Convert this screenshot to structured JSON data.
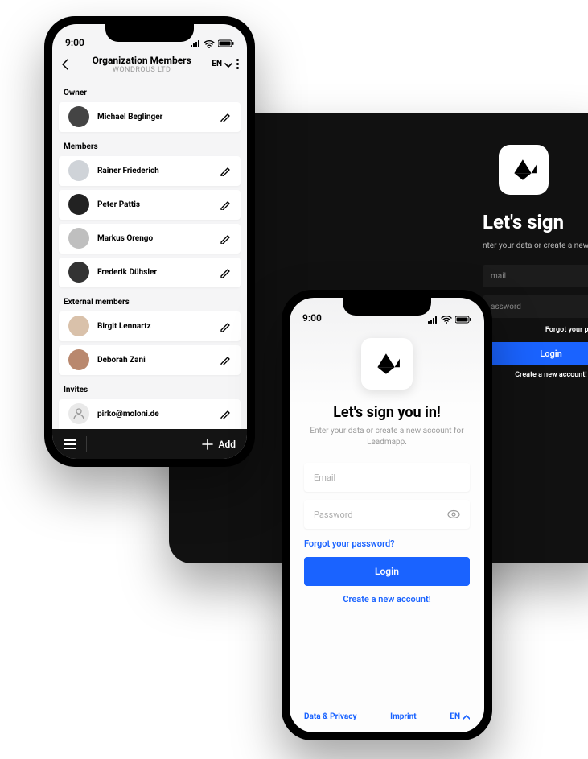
{
  "statusbar": {
    "time": "9:00"
  },
  "tablet": {
    "title": "Let's sign ",
    "subtitle": "nter your data or create a new",
    "email_placeholder": "mail",
    "password_placeholder": "assword",
    "forgot": "Forgot your password?",
    "login": "Login",
    "create": "Create a new account!"
  },
  "phone1": {
    "header": {
      "title": "Organization Members",
      "subtitle": "WONDROUS LTD",
      "lang": "EN"
    },
    "sections": {
      "owner": {
        "label": "Owner",
        "items": [
          {
            "name": "Michael Beglinger"
          }
        ]
      },
      "members": {
        "label": "Members",
        "items": [
          {
            "name": "Rainer Friederich"
          },
          {
            "name": "Peter Pattis"
          },
          {
            "name": "Markus Orengo"
          },
          {
            "name": "Frederik Dühsler"
          }
        ]
      },
      "external": {
        "label": "External members",
        "items": [
          {
            "name": "Birgit Lennartz"
          },
          {
            "name": "Deborah Zani"
          }
        ]
      },
      "invites": {
        "label": "Invites",
        "items": [
          {
            "name": "pirko@moloni.de"
          }
        ]
      }
    },
    "footer": {
      "add": "Add"
    }
  },
  "phone2": {
    "title": "Let's sign you in!",
    "subtitle": "Enter your data or create a new account for Leadmapp.",
    "email_placeholder": "Email",
    "password_placeholder": "Password",
    "forgot": "Forgot your password?",
    "login": "Login",
    "create": "Create a new account!",
    "footer": {
      "privacy": "Data & Privacy",
      "imprint": "Imprint",
      "lang": "EN"
    }
  }
}
